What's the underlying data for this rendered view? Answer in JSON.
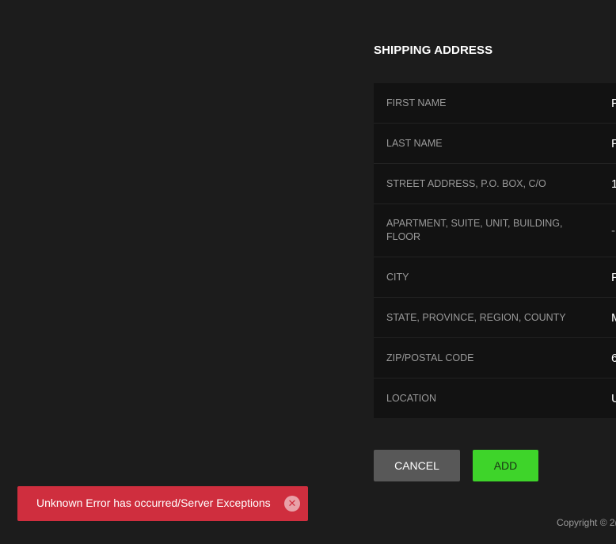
{
  "shipping": {
    "title": "SHIPPING ADDRESS",
    "rows": [
      {
        "label": "FIRST NAME",
        "value": "P"
      },
      {
        "label": "LAST NAME",
        "value": "P"
      },
      {
        "label": "STREET ADDRESS, P.O. BOX, C/O",
        "value": "1"
      },
      {
        "label": "APARTMENT, SUITE, UNIT, BUILDING, FLOOR",
        "value": "-"
      },
      {
        "label": "CITY",
        "value": "P"
      },
      {
        "label": "STATE, PROVINCE, REGION, COUNTY",
        "value": "M"
      },
      {
        "label": "ZIP/POSTAL CODE",
        "value": "6"
      },
      {
        "label": "LOCATION",
        "value": "U"
      }
    ]
  },
  "actions": {
    "cancel_label": "CANCEL",
    "add_label": "ADD"
  },
  "footer": {
    "copyright": "Copyright © 2("
  },
  "toast": {
    "message": "Unknown Error has occurred/Server Exceptions",
    "close_glyph": "✕"
  },
  "colors": {
    "background": "#1c1c1c",
    "table_bg": "#121212",
    "add_button": "#3ed42a",
    "cancel_button": "#585858",
    "error_toast": "#cf2e3e"
  }
}
